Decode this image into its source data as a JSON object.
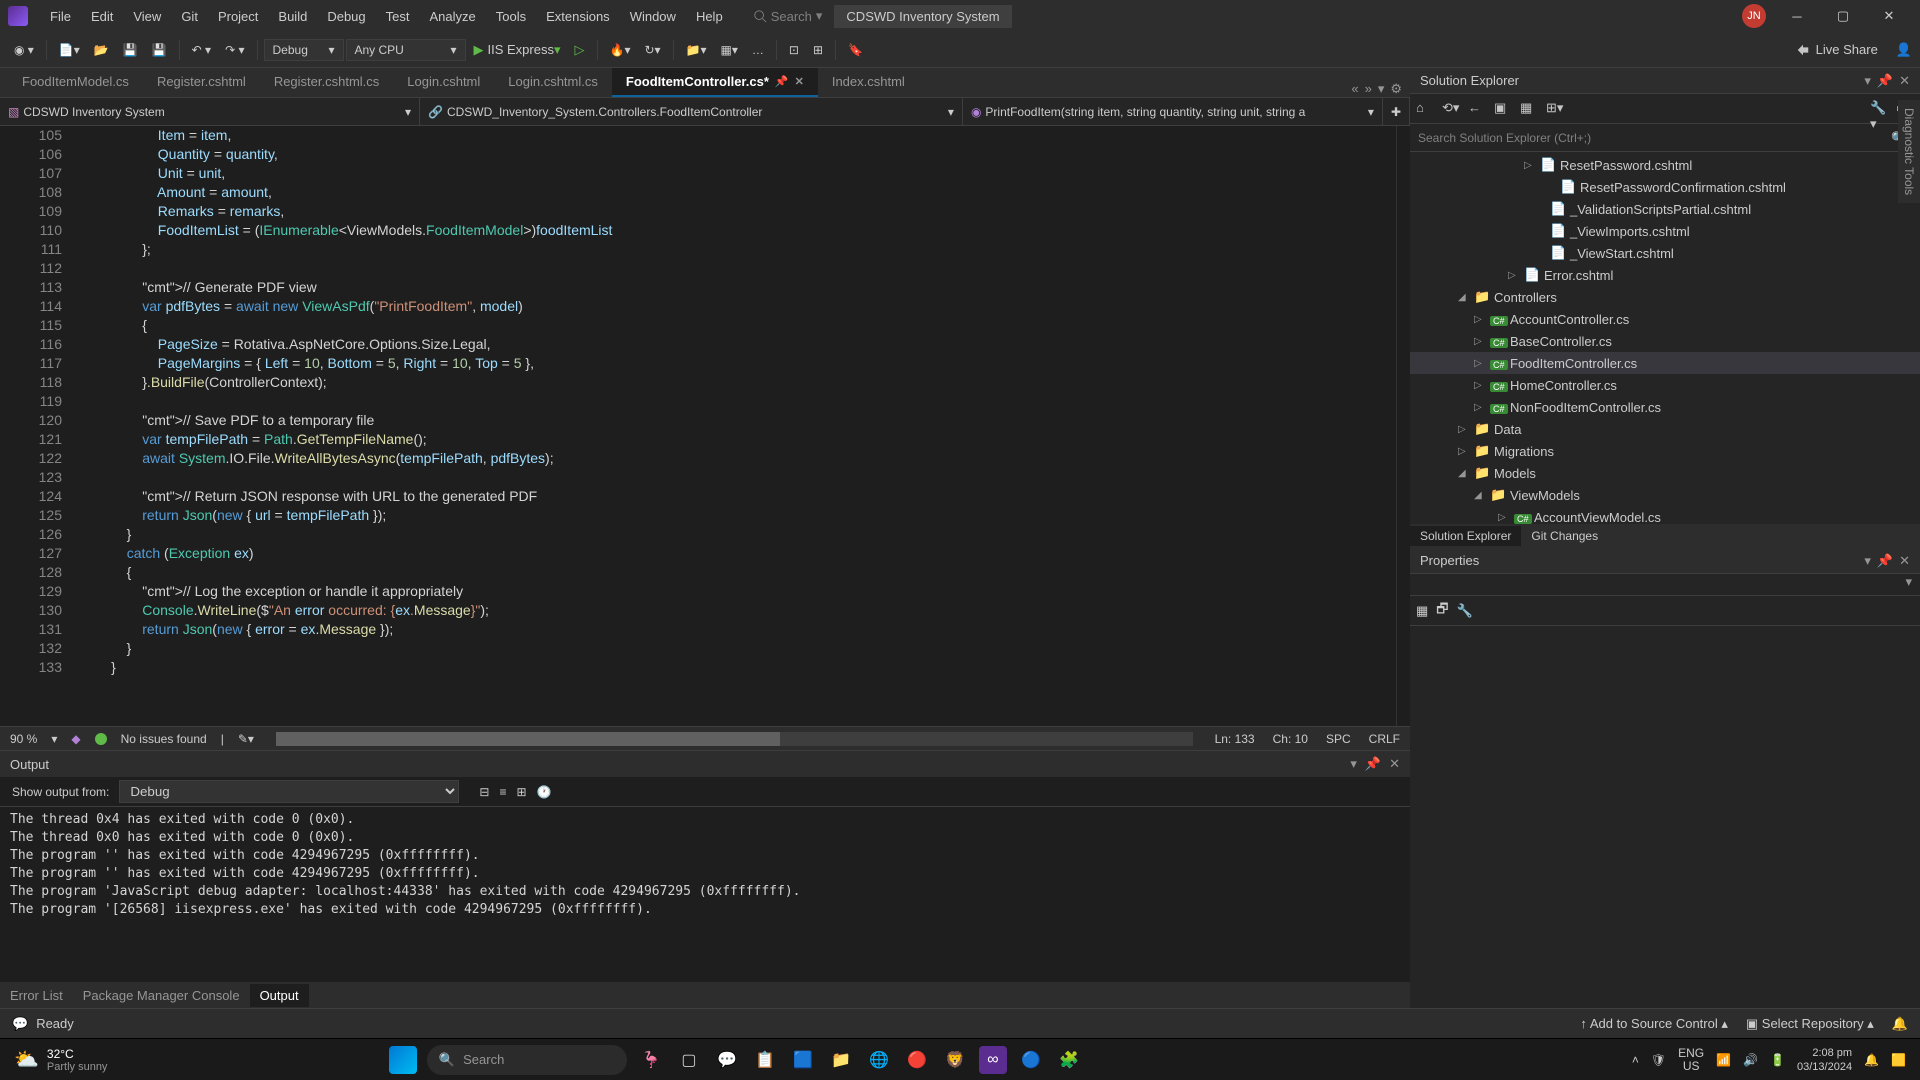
{
  "menu": [
    "File",
    "Edit",
    "View",
    "Git",
    "Project",
    "Build",
    "Debug",
    "Test",
    "Analyze",
    "Tools",
    "Extensions",
    "Window",
    "Help"
  ],
  "search_label": "Search",
  "project_title": "CDSWD Inventory System",
  "user_initials": "JN",
  "toolbar": {
    "config": "Debug",
    "platform": "Any CPU",
    "run_target": "IIS Express",
    "live_share": "Live Share"
  },
  "tabs": [
    {
      "label": "FoodItemModel.cs"
    },
    {
      "label": "Register.cshtml"
    },
    {
      "label": "Register.cshtml.cs"
    },
    {
      "label": "Login.cshtml"
    },
    {
      "label": "Login.cshtml.cs"
    },
    {
      "label": "FoodItemController.cs*",
      "active": true
    },
    {
      "label": "Index.cshtml"
    }
  ],
  "nav": {
    "project": "CDSWD Inventory System",
    "class": "CDSWD_Inventory_System.Controllers.FoodItemController",
    "member": "PrintFoodItem(string item, string quantity, string unit, string a"
  },
  "code_start_line": 105,
  "code_lines": [
    "                    Item = item,",
    "                    Quantity = quantity,",
    "                    Unit = unit,",
    "                    Amount = amount,",
    "                    Remarks = remarks,",
    "                    FoodItemList = (IEnumerable<ViewModels.FoodItemModel>)foodItemList",
    "                };",
    "",
    "                // Generate PDF view",
    "                var pdfBytes = await new ViewAsPdf(\"PrintFoodItem\", model)",
    "                {",
    "                    PageSize = Rotativa.AspNetCore.Options.Size.Legal,",
    "                    PageMargins = { Left = 10, Bottom = 5, Right = 10, Top = 5 },",
    "                }.BuildFile(ControllerContext);",
    "",
    "                // Save PDF to a temporary file",
    "                var tempFilePath = Path.GetTempFileName();",
    "                await System.IO.File.WriteAllBytesAsync(tempFilePath, pdfBytes);",
    "",
    "                // Return JSON response with URL to the generated PDF",
    "                return Json(new { url = tempFilePath });",
    "            }",
    "            catch (Exception ex)",
    "            {",
    "                // Log the exception or handle it appropriately",
    "                Console.WriteLine($\"An error occurred: {ex.Message}\");",
    "                return Json(new { error = ex.Message });",
    "            }",
    "        }"
  ],
  "editor_status": {
    "zoom": "90 %",
    "issues": "No issues found",
    "ln": "Ln: 133",
    "ch": "Ch: 10",
    "spc": "SPC",
    "crlf": "CRLF"
  },
  "output": {
    "title": "Output",
    "show_from_label": "Show output from:",
    "source": "Debug",
    "lines": [
      "The thread 0x4 has exited with code 0 (0x0).",
      "The thread 0x0 has exited with code 0 (0x0).",
      "The program '' has exited with code 4294967295 (0xffffffff).",
      "The program '' has exited with code 4294967295 (0xffffffff).",
      "The program 'JavaScript debug adapter: localhost:44338' has exited with code 4294967295 (0xffffffff).",
      "The program '[26568] iisexpress.exe' has exited with code 4294967295 (0xffffffff)."
    ]
  },
  "bottom_tabs": [
    "Error List",
    "Package Manager Console",
    "Output"
  ],
  "bottom_active": "Output",
  "solution_explorer": {
    "title": "Solution Explorer",
    "search_placeholder": "Search Solution Explorer (Ctrl+;)",
    "items": [
      {
        "indent": 110,
        "chev": "▷",
        "icon": "file",
        "label": "ResetPassword.cshtml"
      },
      {
        "indent": 130,
        "chev": "",
        "icon": "file",
        "label": "ResetPasswordConfirmation.cshtml"
      },
      {
        "indent": 120,
        "chev": "",
        "icon": "file",
        "label": "_ValidationScriptsPartial.cshtml"
      },
      {
        "indent": 120,
        "chev": "",
        "icon": "file",
        "label": "_ViewImports.cshtml"
      },
      {
        "indent": 120,
        "chev": "",
        "icon": "file",
        "label": "_ViewStart.cshtml"
      },
      {
        "indent": 94,
        "chev": "▷",
        "icon": "file",
        "label": "Error.cshtml"
      },
      {
        "indent": 44,
        "chev": "◢",
        "icon": "folder",
        "label": "Controllers"
      },
      {
        "indent": 60,
        "chev": "▷",
        "icon": "cs",
        "label": "AccountController.cs"
      },
      {
        "indent": 60,
        "chev": "▷",
        "icon": "cs",
        "label": "BaseController.cs"
      },
      {
        "indent": 60,
        "chev": "▷",
        "icon": "cs",
        "label": "FoodItemController.cs",
        "selected": true
      },
      {
        "indent": 60,
        "chev": "▷",
        "icon": "cs",
        "label": "HomeController.cs"
      },
      {
        "indent": 60,
        "chev": "▷",
        "icon": "cs",
        "label": "NonFoodItemController.cs"
      },
      {
        "indent": 44,
        "chev": "▷",
        "icon": "folder",
        "label": "Data"
      },
      {
        "indent": 44,
        "chev": "▷",
        "icon": "folder",
        "label": "Migrations"
      },
      {
        "indent": 44,
        "chev": "◢",
        "icon": "folder",
        "label": "Models"
      },
      {
        "indent": 60,
        "chev": "◢",
        "icon": "folder",
        "label": "ViewModels"
      },
      {
        "indent": 84,
        "chev": "▷",
        "icon": "cs",
        "label": "AccountViewModel.cs"
      }
    ],
    "bottom_tabs": [
      "Solution Explorer",
      "Git Changes"
    ]
  },
  "properties": {
    "title": "Properties"
  },
  "statusbar": {
    "ready": "Ready",
    "add_source": "Add to Source Control",
    "select_repo": "Select Repository"
  },
  "vtab": "Diagnostic Tools",
  "taskbar": {
    "temp": "32°C",
    "cond": "Partly sunny",
    "search": "Search",
    "lang1": "ENG",
    "lang2": "US",
    "time": "2:08 pm",
    "date": "03/13/2024"
  }
}
